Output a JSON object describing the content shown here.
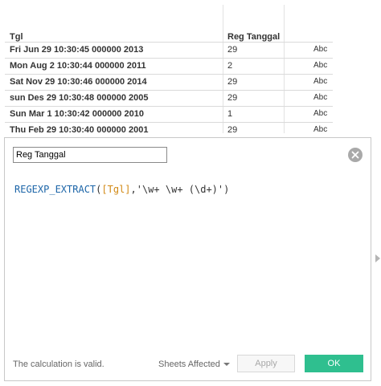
{
  "table": {
    "columns": [
      "Tgl",
      "Reg Tanggal",
      ""
    ],
    "rows": [
      {
        "tgl": "Fri Jun 29 10:30:45 000000 2013",
        "reg": "29",
        "abc": "Abc"
      },
      {
        "tgl": "Mon Aug 2 10:30:44 000000 2011",
        "reg": "2",
        "abc": "Abc"
      },
      {
        "tgl": "Sat Nov 29 10:30:46 000000 2014",
        "reg": "29",
        "abc": "Abc"
      },
      {
        "tgl": "sun Des 29 10:30:48 000000 2005",
        "reg": "29",
        "abc": "Abc"
      },
      {
        "tgl": "Sun Mar 1 10:30:42 000000 2010",
        "reg": "1",
        "abc": "Abc"
      },
      {
        "tgl": "Thu Feb 29 10:30:40 000000 2001",
        "reg": "29",
        "abc": "Abc"
      }
    ]
  },
  "editor": {
    "name_value": "Reg Tanggal",
    "formula": {
      "function": "REGEXP_EXTRACT",
      "open": "(",
      "field": "[Tgl]",
      "comma": ",",
      "pattern": "'\\w+ \\w+ (\\d+)'",
      "close": ")"
    },
    "close_icon": "close-circle-icon",
    "status": "The calculation is valid.",
    "sheets_affected": "Sheets Affected",
    "apply_label": "Apply",
    "ok_label": "OK"
  },
  "colors": {
    "ok_button": "#2fbf8f",
    "function_text": "#1c65a8",
    "field_text": "#d28a16"
  }
}
